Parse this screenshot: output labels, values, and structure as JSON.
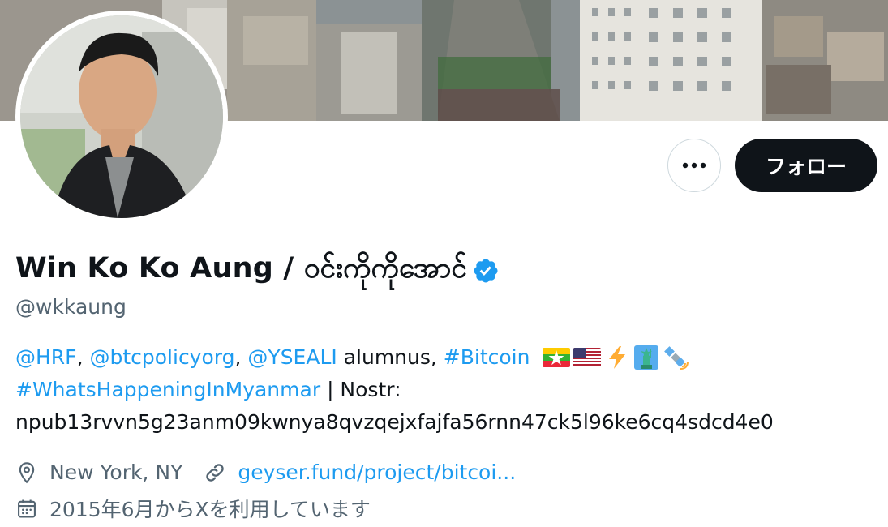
{
  "profile": {
    "name": "Win Ko Ko Aung / ဝင်းကိုကိုအောင်",
    "handle": "@wkkaung",
    "verified": true
  },
  "actions": {
    "follow_label": "フォロー",
    "more_icon": "ellipsis-icon"
  },
  "bio": {
    "mention_hrf": "@HRF",
    "sep1": ",",
    "mention_btc": "@btcpolicyorg",
    "sep2": ",",
    "mention_ysea": "@YSEALI",
    "alumnus": "alumnus,",
    "hashtag_bitcoin": "#Bitcoin",
    "emojis": [
      "myanmar-flag",
      "us-flag",
      "lightning",
      "statue-of-liberty",
      "satellite"
    ],
    "hashtag_myanmar": "#WhatsHappeningInMyanmar",
    "nostr_label": "| Nostr:",
    "npub": "npub13rvvn5g23anm09kwnya8qvzqejxfajfa56rnn47ck5l96ke6cq4sdcd4e0"
  },
  "meta": {
    "location": "New York, NY",
    "website": "geyser.fund/project/bitcoi...",
    "joined": "2015年6月からXを利用しています"
  },
  "colors": {
    "link": "#1d9bf0",
    "text": "#0f1419",
    "secondary": "#536471",
    "follow_bg": "#0f1419",
    "verified": "#1d9bf0"
  }
}
